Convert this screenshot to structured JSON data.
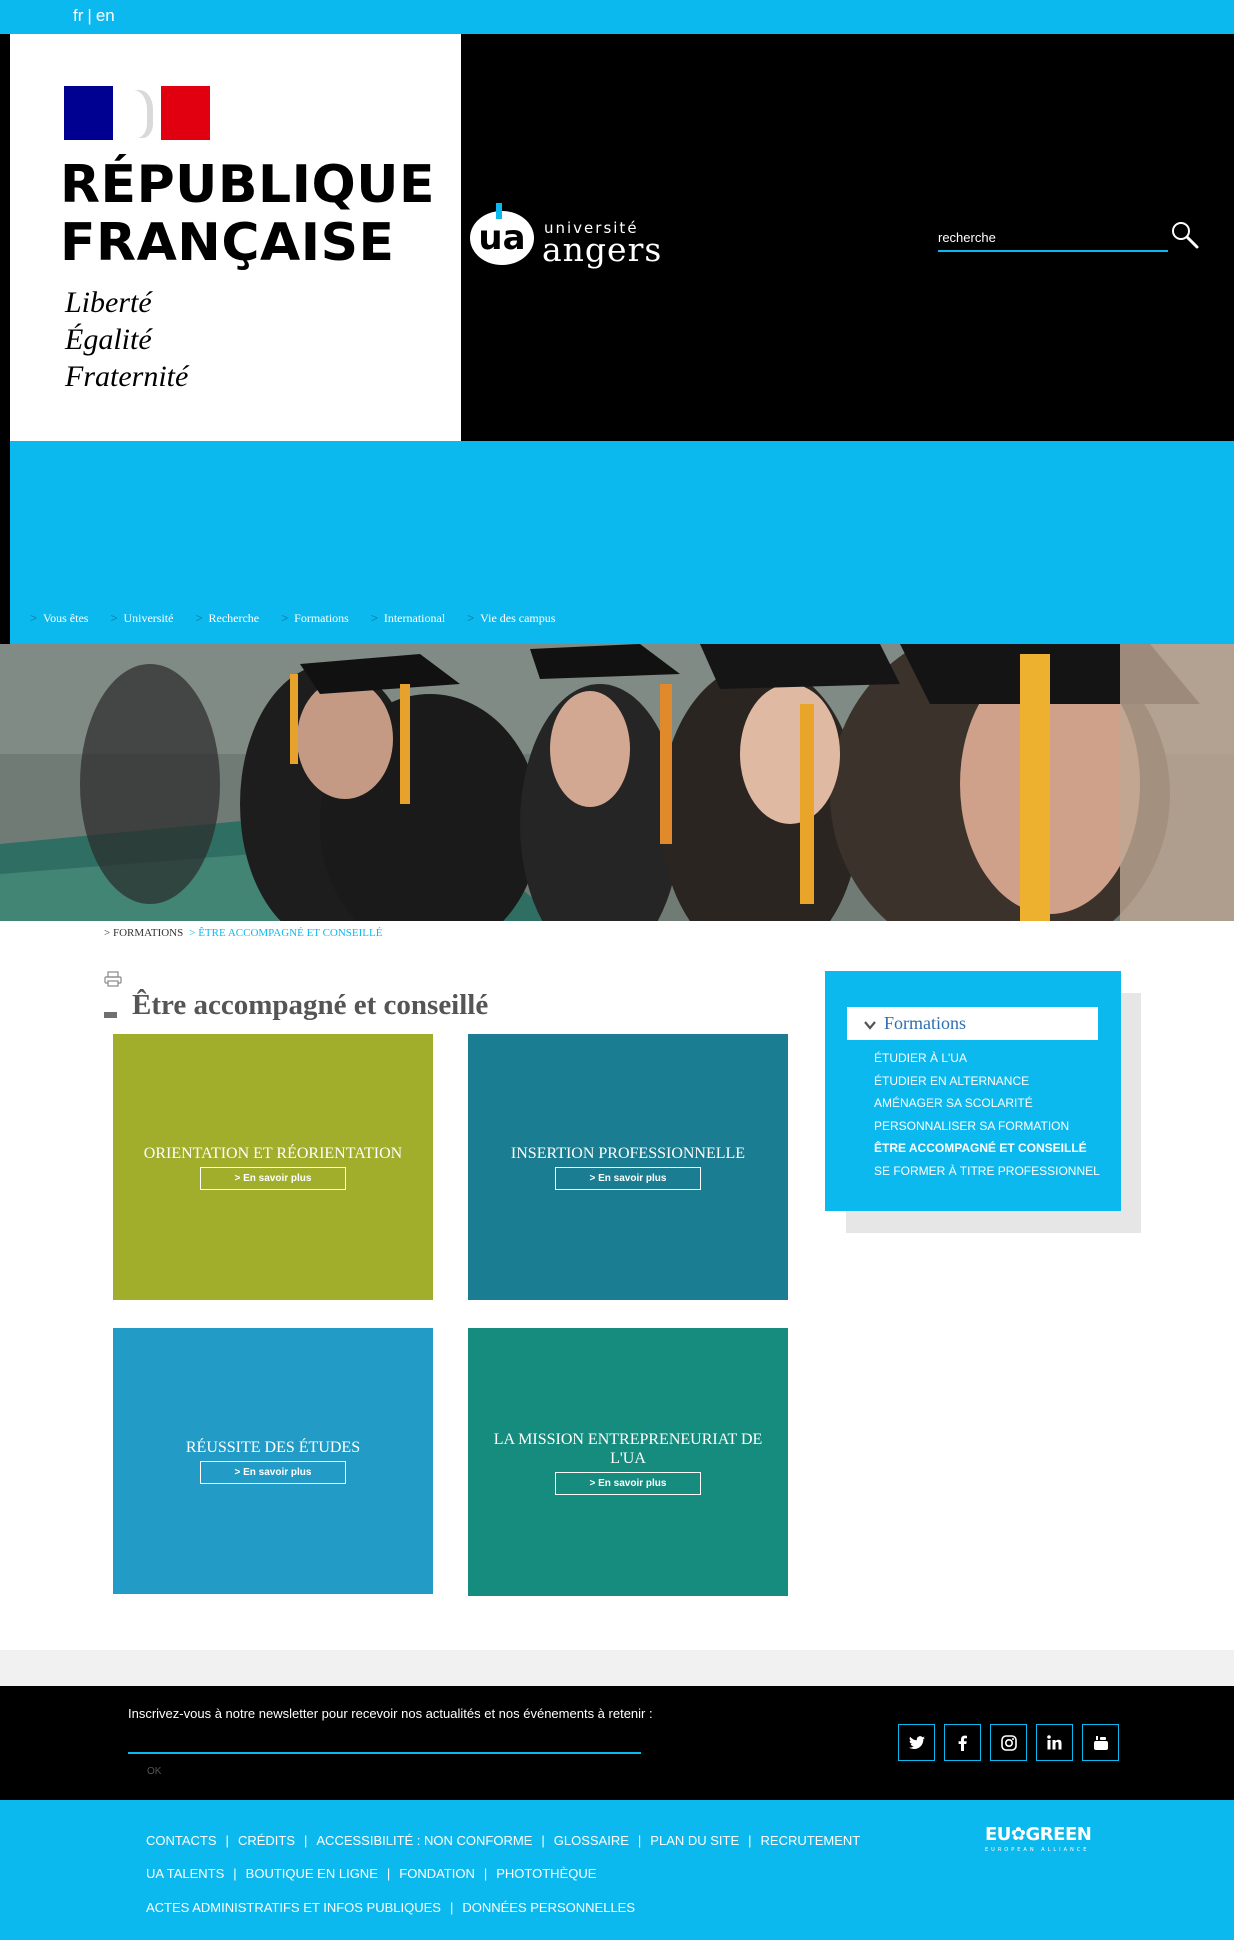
{
  "lang_bar": {
    "fr": "fr",
    "separator": "|",
    "en": "en"
  },
  "gov_logo": {
    "title_line1": "RÉPUBLIQUE",
    "title_line2": "FRANÇAISE",
    "motto_1": "Liberté",
    "motto_2": "Égalité",
    "motto_3": "Fraternité"
  },
  "university_logo": {
    "monogram": "ua",
    "line1": "université",
    "line2": "angers"
  },
  "search": {
    "placeholder": "recherche"
  },
  "nav": {
    "items": [
      "Vous êtes",
      "Université",
      "Recherche",
      "Formations",
      "International",
      "Vie des campus"
    ],
    "chevron": ">"
  },
  "breadcrumb": {
    "parent": "> FORMATIONS",
    "current": "> ÊTRE ACCOMPAGNÉ ET CONSEILLÉ"
  },
  "page": {
    "title": "Être accompagné et conseillé"
  },
  "tiles": [
    {
      "title": "ORIENTATION ET RÉORIENTATION",
      "button": "> En savoir plus",
      "color": "#a1ae2c"
    },
    {
      "title": "INSERTION PROFESSIONNELLE",
      "button": "> En savoir plus",
      "color": "#1b7d91"
    },
    {
      "title": "RÉUSSITE DES ÉTUDES",
      "button": "> En savoir plus",
      "color": "#229cc7"
    },
    {
      "title": "LA MISSION ENTREPRENEURIAT DE L'UA",
      "button": "> En savoir plus",
      "color": "#168c7f"
    }
  ],
  "sidebar": {
    "title": "Formations",
    "items": [
      "ÉTUDIER À L'UA",
      "ÉTUDIER EN ALTERNANCE",
      "AMÉNAGER SA SCOLARITÉ",
      "PERSONNALISER SA FORMATION",
      "ÊTRE ACCOMPAGNÉ ET CONSEILLÉ",
      "SE FORMER À TITRE PROFESSIONNEL"
    ],
    "active_item": "ÊTRE ACCOMPAGNÉ ET CONSEILLÉ"
  },
  "newsletter": {
    "text": "Inscrivez-vous à notre newsletter pour recevoir nos actualités et nos événements à retenir :",
    "ok": "OK"
  },
  "social": [
    "twitter-icon",
    "facebook-icon",
    "instagram-icon",
    "linkedin-icon",
    "youtube-icon"
  ],
  "footer": {
    "row1": [
      "CONTACTS",
      "CRÉDITS",
      "ACCESSIBILITÉ : NON CONFORME",
      "GLOSSAIRE",
      "PLAN DU SITE",
      "RECRUTEMENT"
    ],
    "row2": [
      "UA TALENTS",
      "BOUTIQUE EN LIGNE",
      "FONDATION",
      "PHOTOTHÈQUE"
    ],
    "row3": [
      "ACTES ADMINISTRATIFS ET INFOS PUBLIQUES",
      "DONNÉES PERSONNELLES"
    ],
    "separator": "|",
    "partner_logo": {
      "left": "EU",
      "right": "GREEN",
      "tagline": "EUROPEAN ALLIANCE"
    }
  },
  "colors": {
    "brand_blue": "#0cb9ef",
    "black": "#000000",
    "title_grey": "#555555",
    "sidebar_title": "#2f6fb4"
  }
}
